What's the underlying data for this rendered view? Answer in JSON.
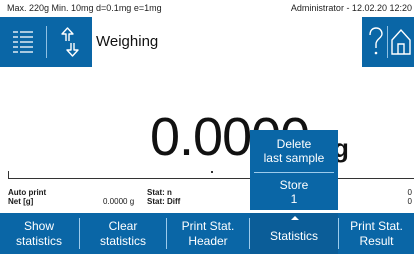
{
  "status_bar": {
    "left": "Max. 220g  Min. 10mg  d=0.1mg  e=1mg",
    "right": "Administrator - 12.02.20 12:20"
  },
  "header": {
    "title": "Weighing"
  },
  "main": {
    "weight_value": "0.0000",
    "unit": "g"
  },
  "info": {
    "auto_print_label": "Auto print",
    "net_label": "Net [g]",
    "net_value": "0.0000 g",
    "stat_n_label": "Stat: n",
    "stat_diff_label": "Stat: Diff",
    "right_top_value": "0",
    "right_bottom_value": "0"
  },
  "popup": {
    "delete_label_line1": "Delete",
    "delete_label_line2": "last sample",
    "store_label": "Store",
    "store_count": "1"
  },
  "footer": {
    "buttons": [
      {
        "line1": "Show",
        "line2": "statistics"
      },
      {
        "line1": "Clear",
        "line2": "statistics"
      },
      {
        "line1": "Print Stat.",
        "line2": "Header"
      },
      {
        "line1": "Statistics",
        "line2": ""
      },
      {
        "line1": "Print Stat.",
        "line2": "Result"
      }
    ]
  },
  "colors": {
    "primary_blue": "#0a66a6",
    "text_white": "#ffffff"
  },
  "icons": [
    "menu-list-icon",
    "up-down-arrow-icon",
    "help-icon",
    "home-icon"
  ]
}
